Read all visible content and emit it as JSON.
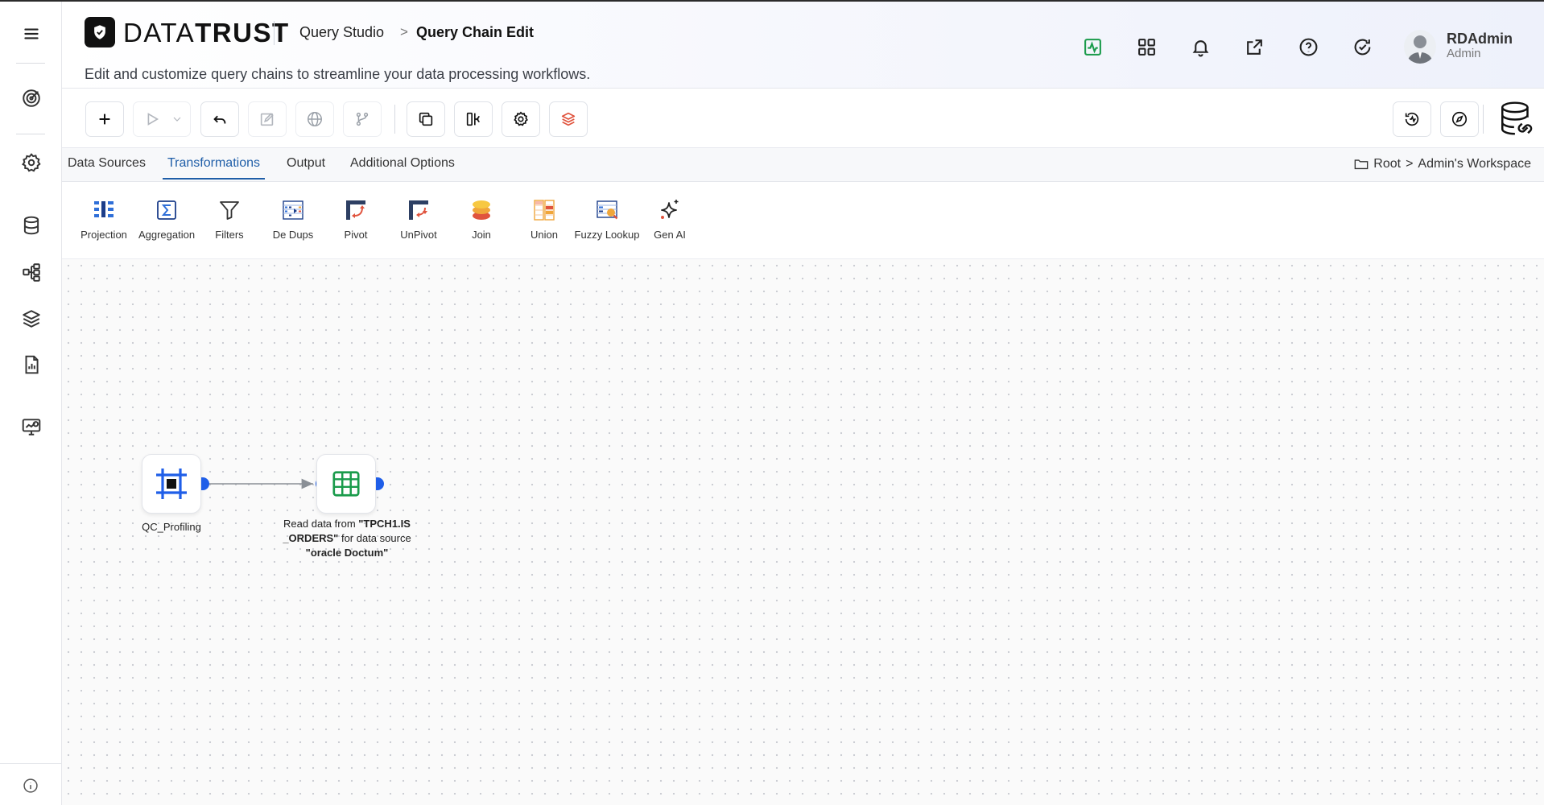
{
  "app": {
    "brand_light": "DATA",
    "brand_bold": "TRUST"
  },
  "header": {
    "breadcrumb_parent": "Query Studio",
    "breadcrumb_separator": ">",
    "page_title": "Query Chain Edit",
    "subtitle": "Edit and customize query chains to streamline your data processing workflows.",
    "icons": [
      "activity-icon",
      "apps-grid-icon",
      "bell-icon",
      "external-link-icon",
      "help-icon",
      "refresh-check-icon"
    ]
  },
  "user": {
    "name": "RDAdmin",
    "role": "Admin"
  },
  "sidebar": {
    "items": [
      "menu-icon",
      "target-icon",
      "settings-icon",
      "database-icon",
      "workflow-icon",
      "layers-icon",
      "report-icon",
      "monitor-icon"
    ]
  },
  "tabs": [
    {
      "label": "Data Sources",
      "active": false
    },
    {
      "label": "Transformations",
      "active": true
    },
    {
      "label": "Output",
      "active": false
    },
    {
      "label": "Additional Options",
      "active": false
    }
  ],
  "workspace_path": {
    "root": "Root",
    "separator": ">",
    "workspace": "Admin's Workspace"
  },
  "palette": [
    {
      "label": "Projection",
      "icon": "projection-icon"
    },
    {
      "label": "Aggregation",
      "icon": "sigma-icon"
    },
    {
      "label": "Filters",
      "icon": "filter-icon"
    },
    {
      "label": "De Dups",
      "icon": "dedup-icon"
    },
    {
      "label": "Pivot",
      "icon": "pivot-icon"
    },
    {
      "label": "UnPivot",
      "icon": "unpivot-icon"
    },
    {
      "label": "Join",
      "icon": "join-icon"
    },
    {
      "label": "Union",
      "icon": "union-icon"
    },
    {
      "label": "Fuzzy Lookup",
      "icon": "fuzzy-lookup-icon"
    },
    {
      "label": "Gen AI",
      "icon": "sparkle-icon"
    }
  ],
  "nodes": {
    "profiling": {
      "label": "QC_Profiling"
    },
    "source": {
      "line1_prefix": "Read data from ",
      "line1_bold": "\"TPCH1.IS",
      "line2_bold": "_ORDERS\"",
      "line2_suffix": " for data source",
      "line3_bold": "\"oracle Doctum\""
    }
  },
  "colors": {
    "accent": "#1f5ea8",
    "port": "#1f5ee8",
    "success": "#1a9b4b",
    "brand": "#111111"
  }
}
